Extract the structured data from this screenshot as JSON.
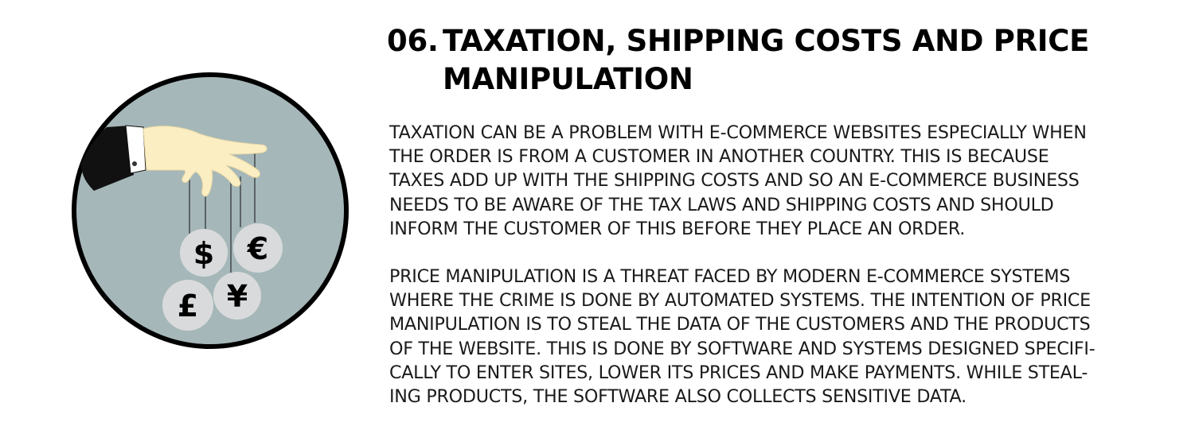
{
  "heading": {
    "number": "06.",
    "line1": "TAXATION, SHIPPING COSTS AND PRICE",
    "line2": "MANIPULATION"
  },
  "paragraphs": [
    {
      "lines": [
        "TAXATION CAN BE A PROBLEM WITH E-COMMERCE WEBSITES ESPECIALLY WHEN",
        "THE ORDER IS FROM A CUSTOMER IN ANOTHER COUNTRY. THIS IS BECAUSE",
        "TAXES ADD UP WITH THE SHIPPING COSTS AND SO AN E-COMMERCE BUSINESS",
        "NEEDS TO BE AWARE OF THE TAX LAWS AND SHIPPING COSTS AND SHOULD",
        "INFORM THE CUSTOMER OF THIS BEFORE THEY PLACE AN ORDER."
      ]
    },
    {
      "lines": [
        "PRICE MANIPULATION IS A THREAT FACED BY MODERN E-COMMERCE SYSTEMS",
        "WHERE THE CRIME IS DONE BY AUTOMATED SYSTEMS. THE INTENTION OF PRICE",
        "MANIPULATION IS TO STEAL THE DATA OF THE CUSTOMERS AND THE PRODUCTS",
        "OF THE WEBSITE. THIS IS DONE BY SOFTWARE AND SYSTEMS DESIGNED SPECIFI-",
        "CALLY TO ENTER SITES, LOWER ITS PRICES AND MAKE PAYMENTS. WHILE STEAL-",
        "ING PRODUCTS, THE SOFTWARE ALSO COLLECTS SENSITIVE DATA."
      ]
    }
  ],
  "illustration": {
    "currency_symbols": {
      "dollar": "$",
      "euro": "€",
      "pound": "£",
      "yen": "¥"
    },
    "colors": {
      "circle_fill": "#a5b7b9",
      "circle_stroke": "#000000",
      "hand": "#fbeec3",
      "coin": "#d9dadb",
      "string": "#5b6366",
      "sleeve": "#111111"
    }
  }
}
